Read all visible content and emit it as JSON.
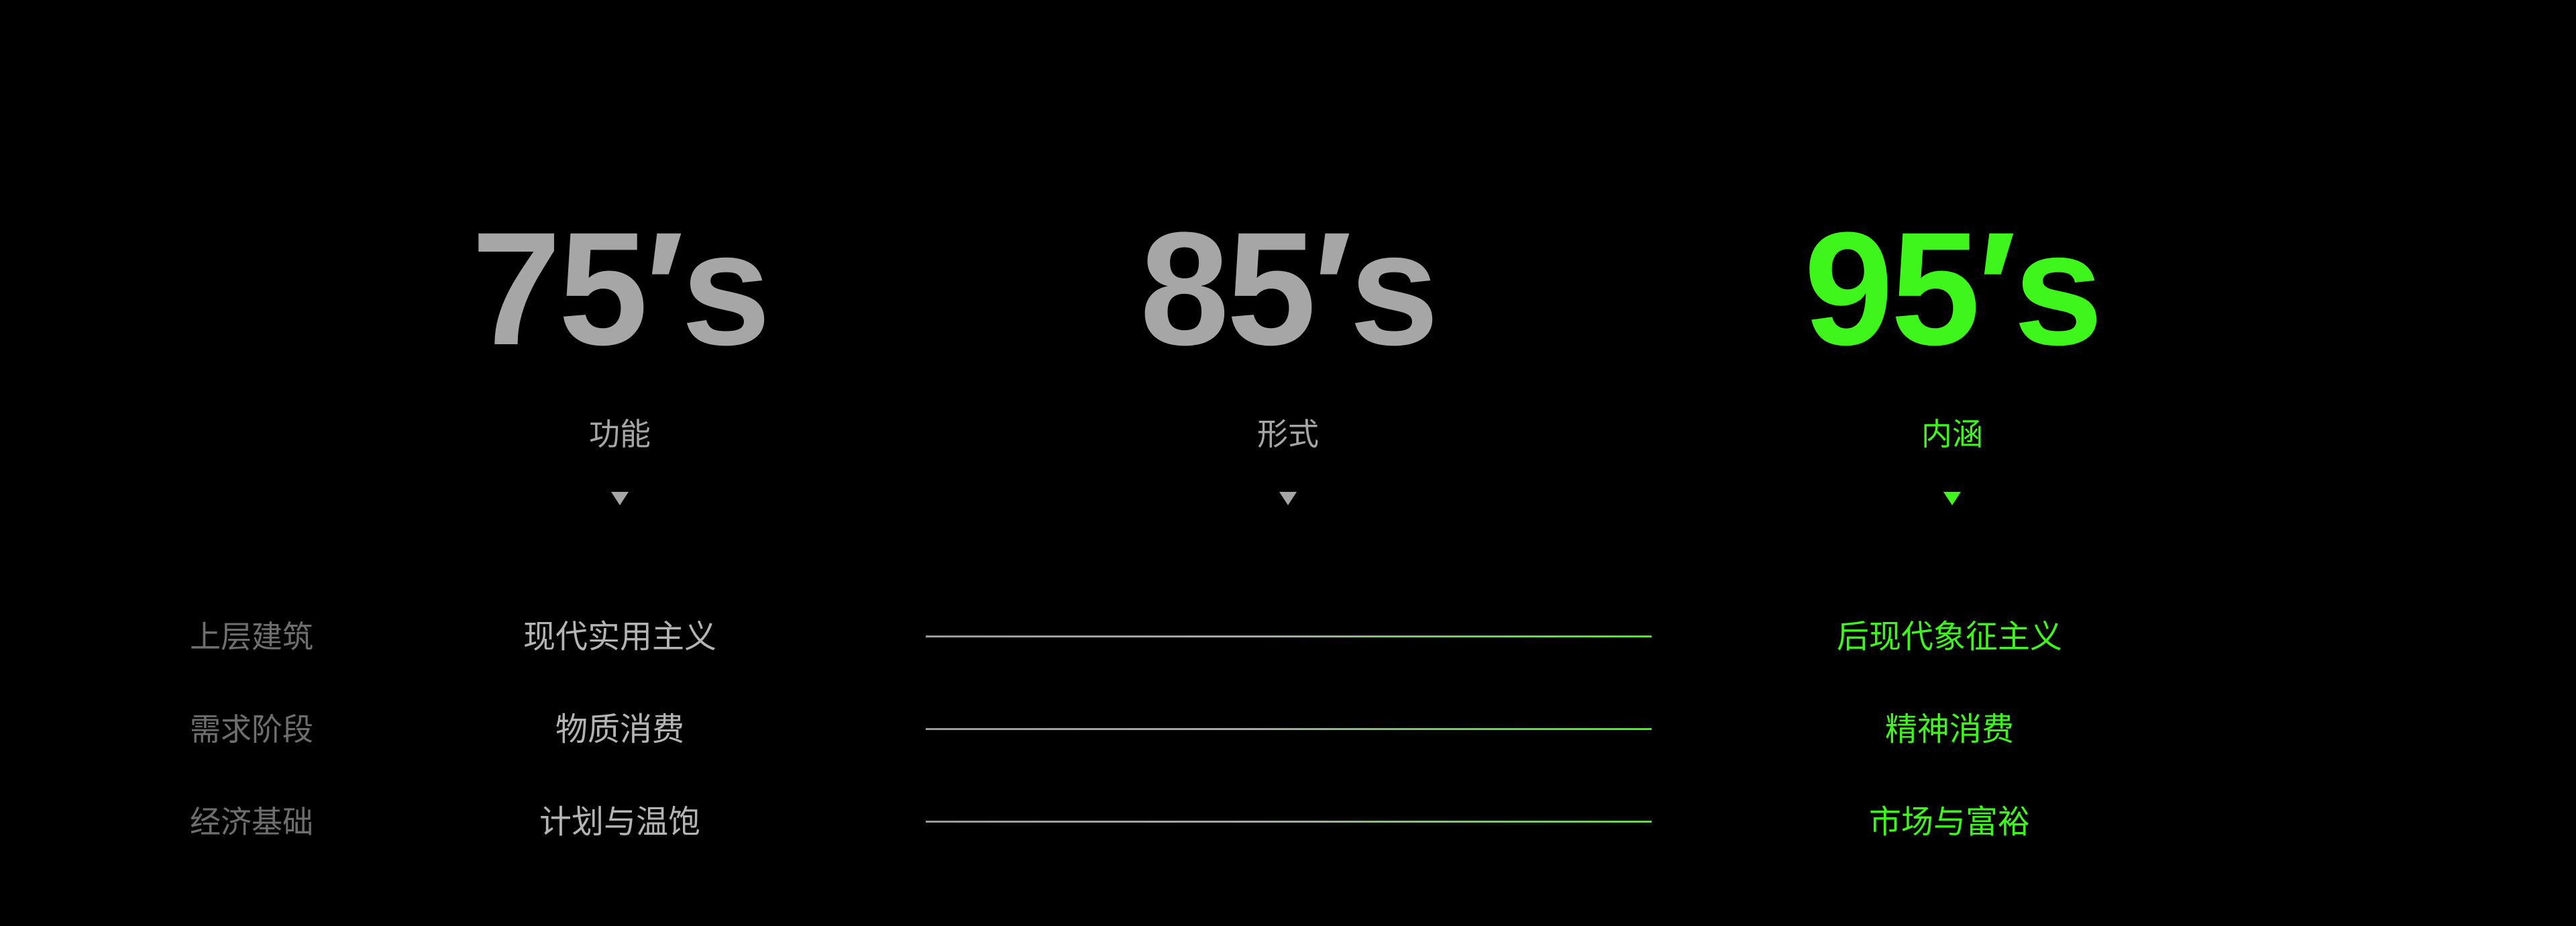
{
  "colors": {
    "background": "#000000",
    "neutral": "#a6a6a6",
    "row_label": "#6e6e6e",
    "accent_green": "#3ef51c"
  },
  "columns": [
    {
      "era": "75′s",
      "aspect": "功能",
      "marker_icon": "triangle-down-icon"
    },
    {
      "era": "85′s",
      "aspect": "形式",
      "marker_icon": "triangle-down-icon"
    },
    {
      "era": "95′s",
      "aspect": "内涵",
      "marker_icon": "triangle-down-icon"
    }
  ],
  "rows": [
    {
      "label": "上层建筑",
      "from": "现代实用主义",
      "to": "后现代象征主义"
    },
    {
      "label": "需求阶段",
      "from": "物质消费",
      "to": "精神消费"
    },
    {
      "label": "经济基础",
      "from": "计划与温饱",
      "to": "市场与富裕"
    }
  ]
}
